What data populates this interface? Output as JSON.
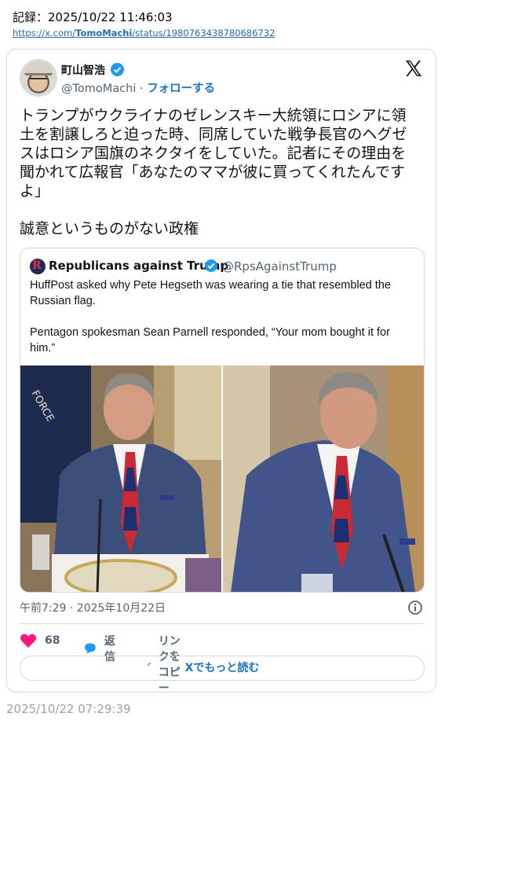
{
  "header": {
    "record_label": "記録：2025/10/22 11:46:03",
    "url_prefix": "https://x.com/",
    "url_user": "TomoMachi",
    "url_suffix": "/status/1980763438780686732"
  },
  "tweet": {
    "author_name": "町山智浩",
    "handle": "@TomoMachi",
    "dot": "·",
    "follow_label": "フォローする",
    "text": "トランプがウクライナのゼレンスキー大統領にロシアに領土を割譲しろと迫った時、同席していた戦争長官のヘグゼスはロシア国旗のネクタイをしていた。記者にその理由を聞かれて広報官「あなたのママが彼に買ってくれたんですよ」\n\n誠意というものがない政権",
    "timestamp": "午前7:29 · 2025年10月22日",
    "likes": "68",
    "reply_label": "返信",
    "copy_link_label": "リンクをコピー",
    "read_more_label": "Xでもっと読む"
  },
  "quote": {
    "author_name": "Republicans against Trump",
    "handle": "@RpsAgainstTrump",
    "text": "HuffPost asked why Pete Hegseth was wearing a tie that resembled the Russian flag.\n\nPentagon spokesman Sean Parnell responded, “Your mom bought it for him.”"
  },
  "capture_time": "2025/10/22 07:29:39",
  "icons": [
    "verified-badge-icon",
    "x-logo-icon",
    "heart-icon",
    "reply-bubble-icon",
    "link-icon",
    "info-icon"
  ],
  "colors": {
    "accent": "#1d9bf0",
    "link": "#1d74c4",
    "like": "#f91880",
    "muted": "#536471",
    "border": "#cfd9de"
  }
}
